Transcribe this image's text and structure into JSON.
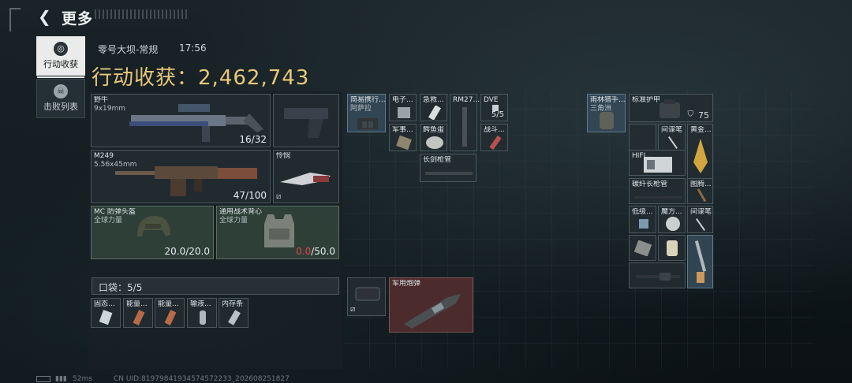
{
  "header": {
    "title": "更多"
  },
  "tabs": [
    {
      "label": "行动收获"
    },
    {
      "label": "击败列表"
    }
  ],
  "raid": {
    "map": "零号大坝-常规",
    "time": "17:56",
    "harvest_label": "行动收获：",
    "harvest_value": "2,462,743"
  },
  "loadout": {
    "primary": {
      "name": "野牛",
      "ammo_type": "9x19mm",
      "ammo": "16/32"
    },
    "secondary": {
      "name": "M249",
      "ammo_type": "5.56x45mm",
      "ammo": "47/100"
    },
    "melee": {
      "name": "怜悯"
    },
    "helmet": {
      "name": "MC 防弹头盔",
      "sub": "全球力量",
      "durability": "20.0/20.0"
    },
    "armor": {
      "name": "通用战术背心",
      "sub": "全球力量",
      "durability_current": "0.0",
      "durability_max": "/50.0"
    }
  },
  "pocket": {
    "label": "口袋：",
    "count": "5",
    "capacity": "/5",
    "items": [
      "固态...",
      "能量...",
      "能量...",
      "输液...",
      "内存条"
    ]
  },
  "rig": {
    "items": [
      {
        "name": "简易携行...",
        "sub": "阿萨拉"
      },
      {
        "name": "电子..."
      },
      {
        "name": "急救..."
      },
      {
        "name": "RM27..."
      },
      {
        "name": "DVE",
        "count": "5/5"
      },
      {
        "name": "军事..."
      },
      {
        "name": "鳄鱼蛋"
      },
      {
        "name": "战斗..."
      },
      {
        "name": "长剑枪管"
      }
    ]
  },
  "backpack_section": {
    "items": [
      {
        "name": ""
      },
      {
        "name": "军用炮弹"
      }
    ]
  },
  "backpack": {
    "header": {
      "name": "雨林猎手...",
      "sub": "三角洲"
    },
    "armor_label": "标准护甲",
    "armor_value": "75",
    "items": [
      {
        "name": "间谍笔"
      },
      {
        "name": "黄金..."
      },
      {
        "name": "HIFI..."
      },
      {
        "name": "碳纤长枪管"
      },
      {
        "name": "图腾..."
      },
      {
        "name": "低级..."
      },
      {
        "name": "魔方..."
      },
      {
        "name": "间谍笔"
      }
    ]
  },
  "footer": {
    "ping": "52ms",
    "uid": "CN UID:8197984193457457223​3_202608251827"
  },
  "colors": {
    "accent_gold": "#e9c77a",
    "damage_red": "#e04848",
    "green_slot": "#30423a"
  }
}
